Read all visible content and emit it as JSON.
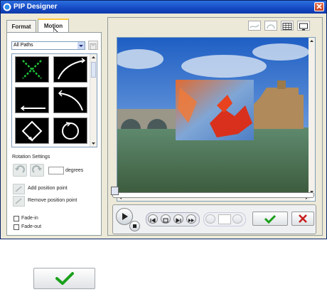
{
  "window": {
    "title": "PIP Designer"
  },
  "tabs": [
    {
      "label": "Format"
    },
    {
      "label": "Motion"
    }
  ],
  "paths": {
    "selected": "All Paths"
  },
  "rotation": {
    "heading": "Rotation Settings",
    "unit_label": "degrees",
    "value": ""
  },
  "position": {
    "add_label": "Add position point",
    "remove_label": "Remove position point"
  },
  "fade": {
    "in_label": "Fade-in",
    "out_label": "Fade-out",
    "in_checked": false,
    "out_checked": false
  },
  "colors": {
    "accent": "#2c6fe0",
    "ok_green": "#1aa01a",
    "cancel_red": "#c81e1e"
  },
  "icons": [
    "save-icon",
    "grid-icon",
    "monitor-icon",
    "play-icon",
    "stop-icon",
    "prev-frame-icon",
    "next-frame-icon",
    "check-icon",
    "close-icon"
  ]
}
